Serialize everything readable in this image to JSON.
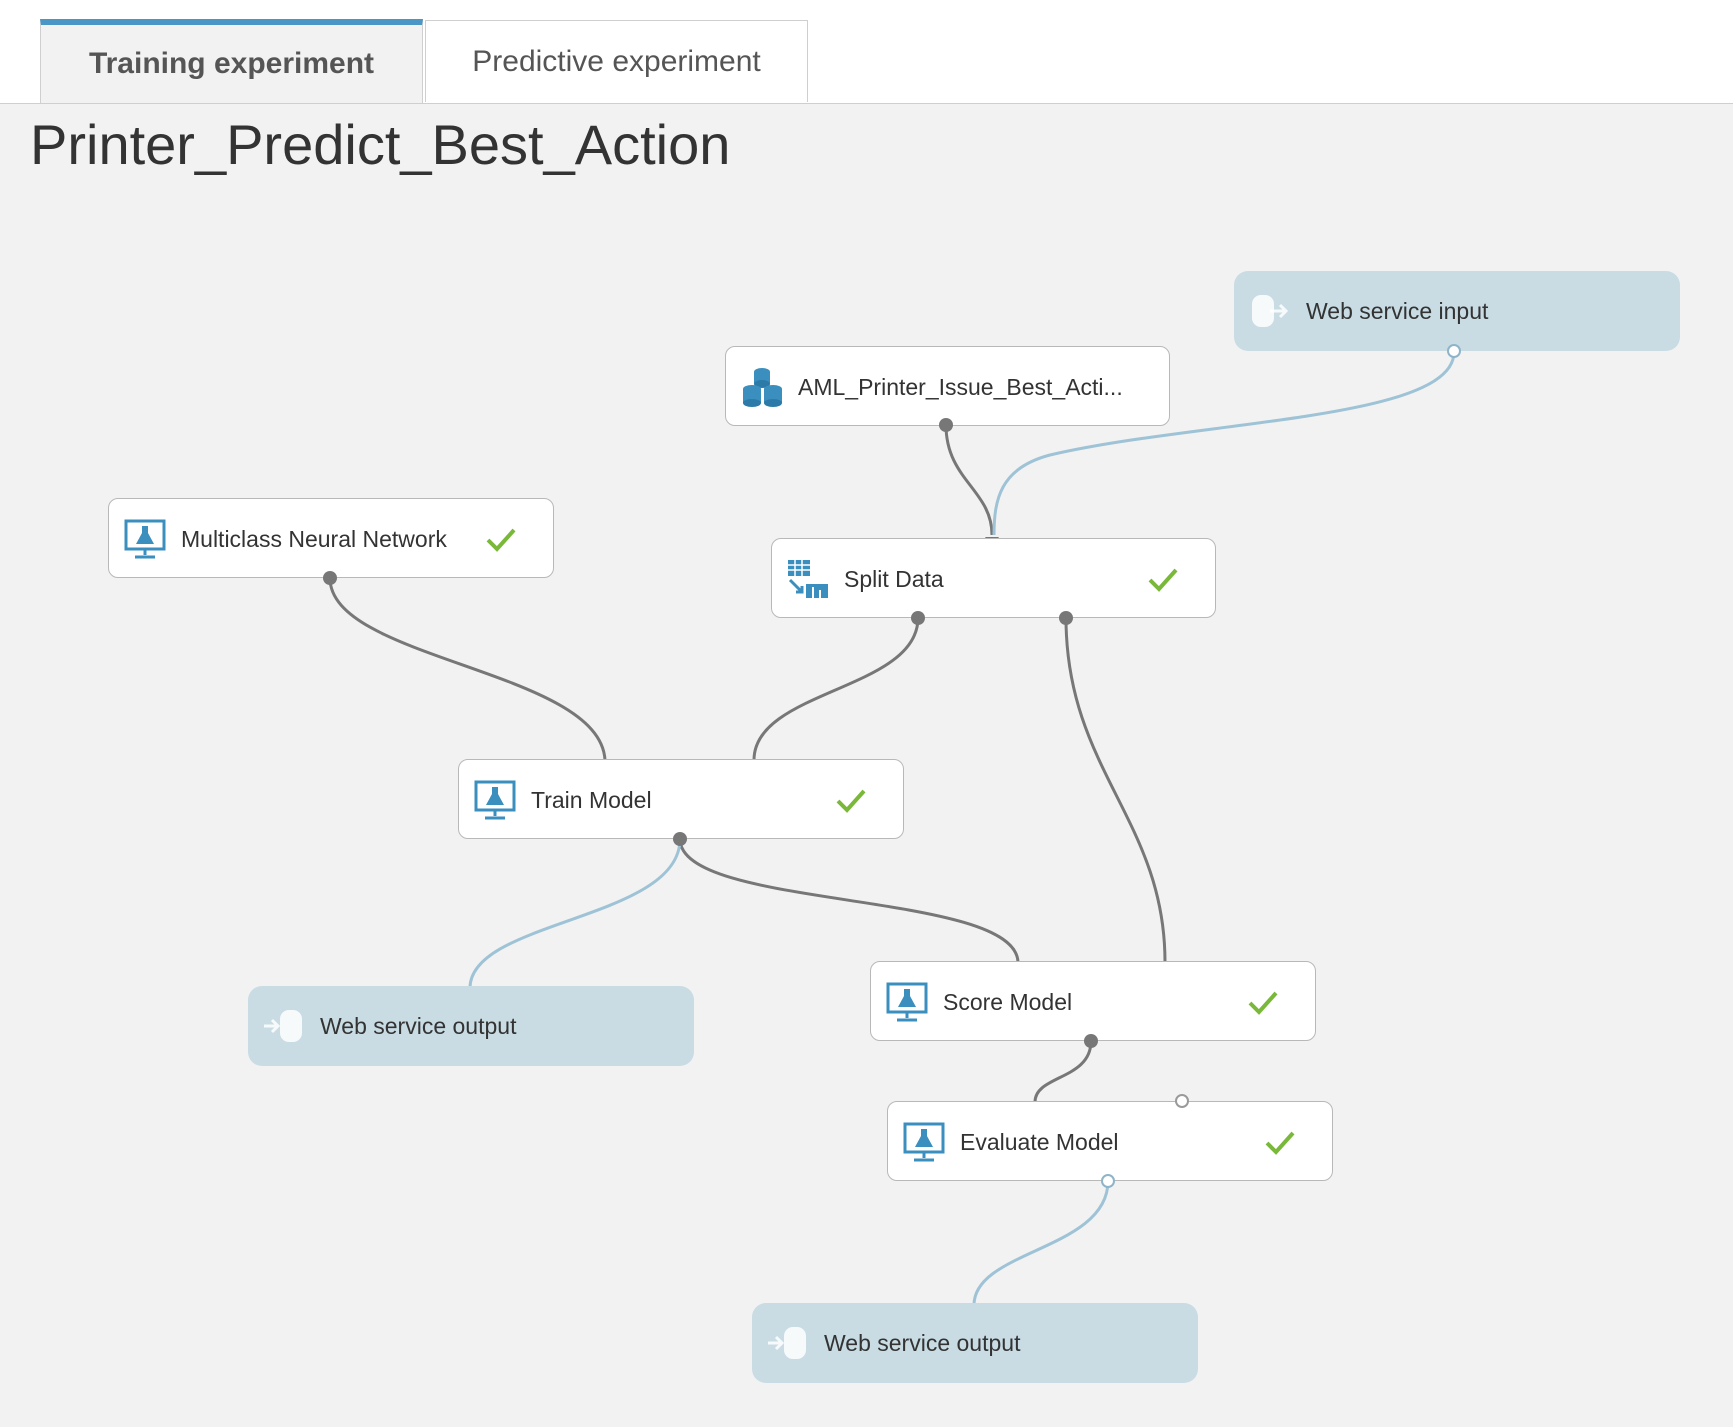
{
  "tabs": {
    "training": "Training experiment",
    "predictive": "Predictive experiment"
  },
  "experiment_title": "Printer_Predict_Best_Action",
  "nodes": {
    "ws_input": "Web service input",
    "dataset": "AML_Printer_Issue_Best_Acti...",
    "neural_net": "Multiclass Neural Network",
    "split_data": "Split Data",
    "train_model": "Train Model",
    "ws_output_1": "Web service output",
    "score_model": "Score Model",
    "evaluate_model": "Evaluate Model",
    "ws_output_2": "Web service output"
  },
  "colors": {
    "accent": "#4a96c4",
    "check": "#7ab83a",
    "wire_grey": "#777777",
    "wire_blue": "#9ec3d6",
    "web_service_bg": "#c9dce4",
    "icon_blue": "#3a8fbf"
  }
}
